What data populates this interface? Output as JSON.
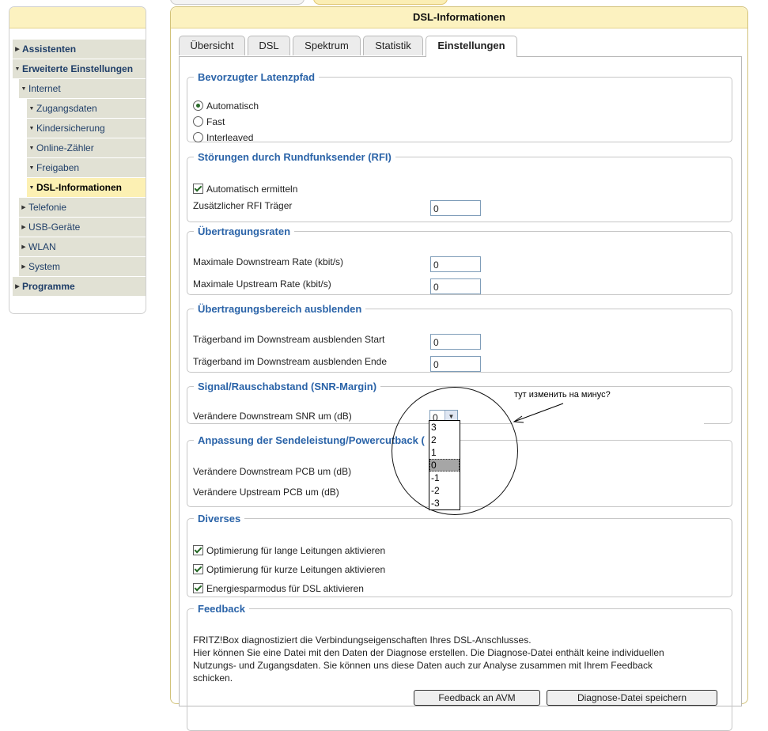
{
  "sidebar": {
    "items": [
      {
        "label": "Assistenten",
        "arrow": "right"
      },
      {
        "label": "Erweiterte Einstellungen",
        "arrow": "down"
      },
      {
        "label": "Internet",
        "arrow": "down"
      },
      {
        "label": "Zugangsdaten",
        "arrow": "down"
      },
      {
        "label": "Kindersicherung",
        "arrow": "down"
      },
      {
        "label": "Online-Zähler",
        "arrow": "down"
      },
      {
        "label": "Freigaben",
        "arrow": "down"
      },
      {
        "label": "DSL-Informationen",
        "arrow": "down"
      },
      {
        "label": "Telefonie",
        "arrow": "right"
      },
      {
        "label": "USB-Geräte",
        "arrow": "right"
      },
      {
        "label": "WLAN",
        "arrow": "right"
      },
      {
        "label": "System",
        "arrow": "right"
      },
      {
        "label": "Programme",
        "arrow": "right"
      }
    ]
  },
  "panel": {
    "title": "DSL-Informationen",
    "tabs": [
      "Übersicht",
      "DSL",
      "Spektrum",
      "Statistik",
      "Einstellungen"
    ],
    "active_tab": "Einstellungen"
  },
  "latency": {
    "legend": "Bevorzugter Latenzpfad",
    "options": [
      "Automatisch",
      "Fast",
      "Interleaved"
    ],
    "selected": "Automatisch"
  },
  "rfi": {
    "legend": "Störungen durch Rundfunksender (RFI)",
    "auto_label": "Automatisch ermitteln",
    "auto_checked": true,
    "extra_label": "Zusätzlicher RFI Träger",
    "extra_value": "0"
  },
  "rates": {
    "legend": "Übertragungsraten",
    "down_label": "Maximale Downstream Rate (kbit/s)",
    "down_value": "0",
    "up_label": "Maximale Upstream Rate (kbit/s)",
    "up_value": "0"
  },
  "hide_range": {
    "legend": "Übertragungsbereich ausblenden",
    "start_label": "Trägerband im Downstream ausblenden Start",
    "start_value": "0",
    "end_label": "Trägerband im Downstream ausblenden Ende",
    "end_value": "0"
  },
  "snr": {
    "legend": "Signal/Rauschabstand (SNR-Margin)",
    "label": "Verändere Downstream SNR um (dB)",
    "value": "0",
    "options": [
      "3",
      "2",
      "1",
      "0",
      "-1",
      "-2",
      "-3"
    ]
  },
  "pcb": {
    "legend": "Anpassung der Sendeleistung/Powercutback (",
    "down_label": "Verändere Downstream PCB um (dB)",
    "up_label": "Verändere Upstream PCB um (dB)"
  },
  "misc": {
    "legend": "Diverses",
    "items": [
      {
        "label": "Optimierung für lange Leitungen aktivieren",
        "checked": true
      },
      {
        "label": "Optimierung für kurze Leitungen aktivieren",
        "checked": true
      },
      {
        "label": "Energiesparmodus für DSL aktivieren",
        "checked": true
      }
    ]
  },
  "feedback": {
    "legend": "Feedback",
    "line1": "FRITZ!Box diagnostiziert die Verbindungseigenschaften Ihres DSL-Anschlusses.",
    "line2": "Hier können Sie eine Datei mit den Daten der Diagnose erstellen. Die Diagnose-Datei enthält keine individuellen",
    "line3": "Nutzungs- und Zugangsdaten. Sie können uns diese Daten auch zur Analyse zusammen mit Ihrem Feedback",
    "line4": "schicken.",
    "button1": "Feedback an AVM",
    "button2": "Diagnose-Datei speichern"
  },
  "annotation": {
    "note": "тут изменить на минус?"
  }
}
